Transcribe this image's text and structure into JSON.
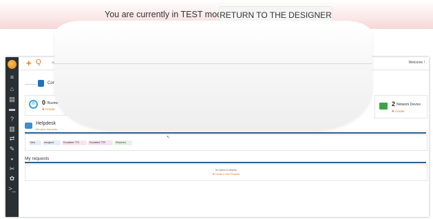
{
  "banner": {
    "text": "You are currently in TEST mode",
    "return_label": "RETURN TO THE DESIGNER"
  },
  "topbar": {
    "plus_icon": "+",
    "search_icon": "Q",
    "menu_dots": "»",
    "welcome": "Welcome !"
  },
  "sidebar": {
    "icons": [
      "≡",
      "⌂",
      "▤",
      "▬",
      "?",
      "▥",
      "⇄",
      "✎",
      "▪",
      "✂",
      "✿",
      ">_"
    ]
  },
  "dashboard": {
    "con_label": "Con",
    "business_count": "0",
    "business_label": "Business F",
    "business_create": "✚ Create",
    "network_count": "2",
    "network_label": "Network Device",
    "network_create": "✚ Create"
  },
  "helpdesk": {
    "title": "Helpdesk",
    "subtitle": "All open requests",
    "chips": [
      {
        "label": "New",
        "color": "#e9ecf5"
      },
      {
        "label": "Assigned",
        "color": "#e6eef8"
      },
      {
        "label": "Escalated TTO",
        "color": "#f7e6ee"
      },
      {
        "label": "Escalated TTR",
        "color": "#f5e4f0"
      },
      {
        "label": "Resolved",
        "color": "#e6f3e6"
      }
    ]
  },
  "my_requests": {
    "title": "My requests",
    "empty": "No object to display.",
    "create": "✚ Create a User Request"
  },
  "colors": {
    "accent": "#e8741e",
    "sidebar": "#2a2f33",
    "blue_bar": "#2b5c91"
  }
}
